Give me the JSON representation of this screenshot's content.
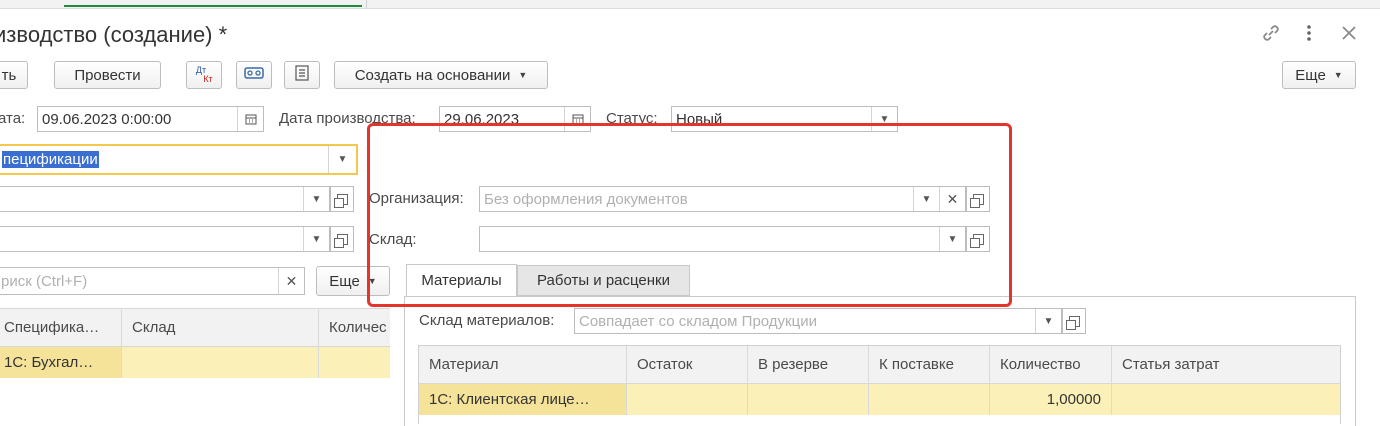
{
  "window": {
    "title": "изводство (создание) *"
  },
  "header_icons": {
    "link": "link-icon",
    "more": "more-vert-icon",
    "close": "close-icon"
  },
  "toolbar": {
    "save_label": "ть",
    "post_label": "Провести",
    "dtkt_top": "Дт",
    "dtkt_bottom": "Кт",
    "create_based_label": "Создать на основании",
    "more_label": "Еще"
  },
  "form": {
    "date_label": "ата:",
    "date_value": "09.06.2023  0:00:00",
    "prod_date_label": "Дата производства:",
    "prod_date_value": "29.06.2023",
    "status_label": "Статус:",
    "status_value": "Новый",
    "spec_value": "пецификации",
    "org_label": "Организация:",
    "org_placeholder": "Без оформления документов",
    "warehouse_label": "Склад:",
    "warehouse_value": ""
  },
  "left_panel": {
    "search_placeholder": "риск (Ctrl+F)",
    "more_label": "Еще",
    "columns": [
      "Специфика…",
      "Склад",
      "Количес"
    ],
    "rows": [
      {
        "spec": "1С: Бухгал…",
        "warehouse": "",
        "qty": ""
      }
    ]
  },
  "tabs": [
    {
      "label": "Материалы",
      "active": true
    },
    {
      "label": "Работы и расценки",
      "active": false
    }
  ],
  "materials": {
    "warehouse_label": "Склад материалов:",
    "warehouse_placeholder": "Совпадает со складом Продукции",
    "columns": [
      "Материал",
      "Остаток",
      "В резерве",
      "К поставке",
      "Количество",
      "Статья затрат"
    ],
    "rows": [
      {
        "material": "1С: Клиентская лице…",
        "balance": "",
        "reserve": "",
        "supply": "",
        "qty": "1,00000",
        "cost_item": ""
      }
    ]
  },
  "colors": {
    "highlight": "#e5342b",
    "selected_row": "#fbf0b8",
    "focus": "#f2c94c",
    "text_select": "#3a6fd1"
  }
}
